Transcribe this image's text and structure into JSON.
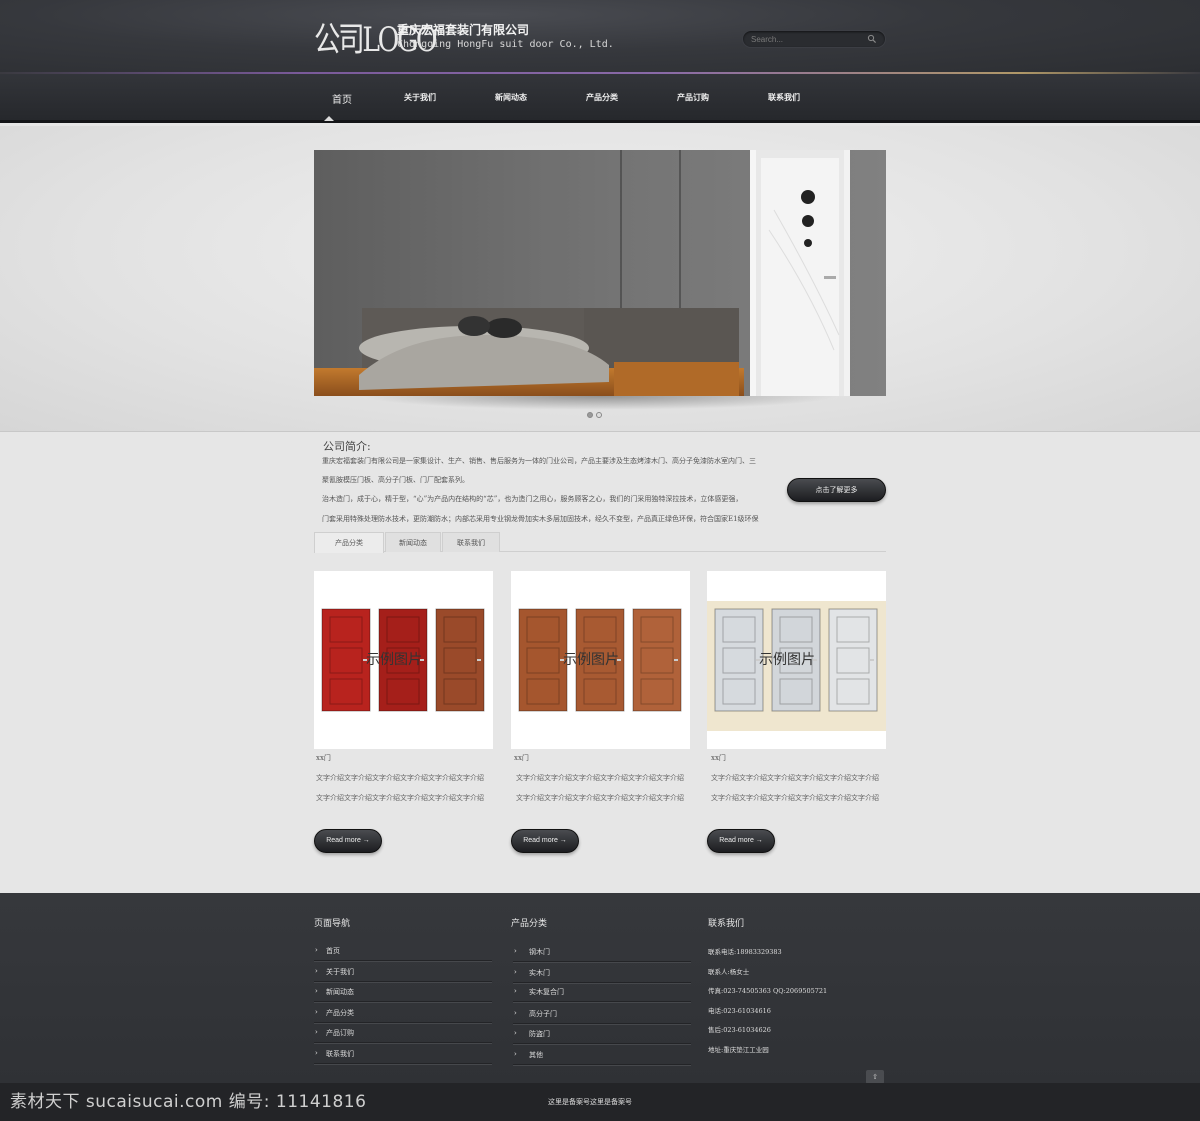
{
  "header": {
    "logo_text": "公司LOGO",
    "company_cn": "重庆宏福套装门有限公司",
    "company_en": "Chongqing HongFu suit door Co., Ltd.",
    "search_placeholder": "Search..."
  },
  "nav": {
    "items": [
      {
        "label": "首页"
      },
      {
        "label": "关于我们"
      },
      {
        "label": "新闻动态"
      },
      {
        "label": "产品分类"
      },
      {
        "label": "产品订购"
      },
      {
        "label": "联系我们"
      }
    ],
    "active_index": 0
  },
  "banner": {
    "slide_count": 2,
    "active_slide": 0
  },
  "intro": {
    "title": "公司简介:",
    "lines": [
      "重庆宏福套装门有限公司是一家集设计、生产、销售、售后服务为一体的门业公司，产品主要涉及生态烤漆木门、高分子免漆防水室内门、三",
      "聚氰胺模压门板、高分子门板、门厂配套系列。",
      "治木造门，成于心，精于型，“心”为产品内在结构的“芯”，也为造门之用心，服务顾客之心，我们的门采用独特深拉技术，立体感更强，",
      "门套采用特殊处理防水技术，更防潮防水；内部芯采用专业钢龙骨加实木多层加固技术，经久不变型，产品真正绿色环保，符合国家E1级环保"
    ],
    "button_label": "点击了解更多"
  },
  "tabs": [
    "产品分类",
    "新闻动态",
    "联系我们"
  ],
  "products": [
    {
      "image_label": "示例图片",
      "name": "xx门",
      "desc1": "文字介绍文字介绍文字介绍文字介绍文字介绍文字介绍",
      "desc2": "文字介绍文字介绍文字介绍文字介绍文字介绍文字介绍",
      "button": "Read more →"
    },
    {
      "image_label": "示例图片",
      "name": "xx门",
      "desc1": "文字介绍文字介绍文字介绍文字介绍文字介绍文字介绍",
      "desc2": "文字介绍文字介绍文字介绍文字介绍文字介绍文字介绍",
      "button": "Read more →"
    },
    {
      "image_label": "示例图片",
      "name": "xx门",
      "desc1": "文字介绍文字介绍文字介绍文字介绍文字介绍文字介绍",
      "desc2": "文字介绍文字介绍文字介绍文字介绍文字介绍文字介绍",
      "button": "Read more →"
    }
  ],
  "door_colors": [
    [
      "#b8231e",
      "#a51f1a",
      "#9a4a2a"
    ],
    [
      "#a5562e",
      "#a85a32",
      "#b0623a"
    ],
    [
      "#d6dade",
      "#d2d6da",
      "#e2e4e6"
    ]
  ],
  "footer": {
    "nav_heading": "页面导航",
    "nav_links": [
      "首页",
      "关于我们",
      "新闻动态",
      "产品分类",
      "产品订购",
      "联系我们"
    ],
    "cat_heading": "产品分类",
    "cat_links": [
      "钢木门",
      "实木门",
      "实木复合门",
      "高分子门",
      "防盗门",
      "其他"
    ],
    "contact_heading": "联系我们",
    "contact_lines": [
      "联系电话:18983329383",
      "联系人:杨女士",
      "传真:023-74505363    QQ:2069505721",
      "电话:023-61034616",
      "售后:023-61034626",
      "地址:重庆垫江工业园"
    ],
    "back_top": "⇧",
    "icp": "这里是备案号这里是备案号"
  },
  "watermark": "素材天下 sucaisucai.com  编号: 11141816"
}
